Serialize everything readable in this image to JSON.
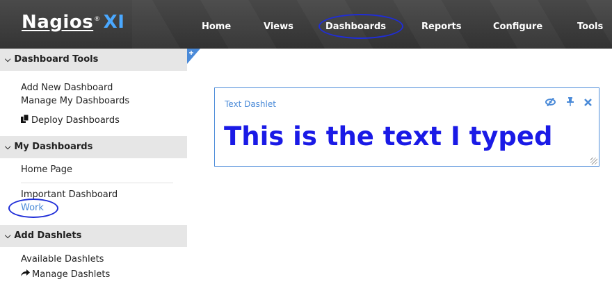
{
  "header": {
    "logo_text": "Nagios",
    "logo_reg": "®",
    "logo_suffix": "XI",
    "nav": [
      {
        "label": "Home"
      },
      {
        "label": "Views"
      },
      {
        "label": "Dashboards"
      },
      {
        "label": "Reports"
      },
      {
        "label": "Configure"
      },
      {
        "label": "Tools"
      }
    ],
    "highlighted_nav": "Dashboards"
  },
  "sidebar": {
    "sections": [
      {
        "title": "Dashboard Tools",
        "items": [
          {
            "label": "Add New Dashboard"
          },
          {
            "label": "Manage My Dashboards"
          },
          {
            "label": "Deploy Dashboards",
            "icon": "copy-icon"
          }
        ]
      },
      {
        "title": "My Dashboards",
        "items": [
          {
            "label": "Home Page"
          },
          {
            "label": "Important Dashboard"
          },
          {
            "label": "Work",
            "active": true
          }
        ]
      },
      {
        "title": "Add Dashlets",
        "items": [
          {
            "label": "Available Dashlets"
          },
          {
            "label": "Manage Dashlets",
            "icon": "share-arrow-icon"
          }
        ]
      }
    ],
    "toggle_icon": "plus-icon"
  },
  "dashlet": {
    "title": "Text Dashlet",
    "text": "This is the text I typed",
    "icons": [
      "hide-eye-icon",
      "pin-icon",
      "close-icon"
    ]
  },
  "colors": {
    "topbar": "#3c3c3c",
    "accent": "#4a8ad8",
    "logo_xi": "#4aa8ff",
    "dashlet_text": "#1a1ae6",
    "annotation_circle": "#1f2dd8",
    "section_header_bg": "#e6e6e6"
  }
}
